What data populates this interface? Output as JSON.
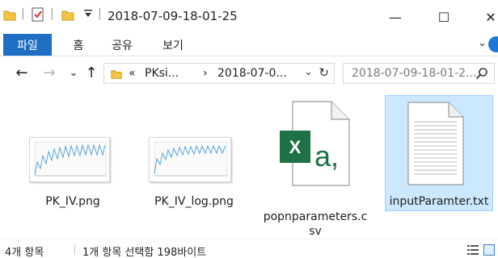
{
  "window": {
    "title": "2018-07-09-18-01-25",
    "buttons": {
      "minimize": "—",
      "maximize": "☐",
      "close": "✕"
    }
  },
  "ribbon": {
    "tabs": [
      {
        "label": "파일"
      },
      {
        "label": "홈"
      },
      {
        "label": "공유"
      },
      {
        "label": "보기"
      }
    ],
    "expand_glyph": "⌄"
  },
  "nav": {
    "back": "←",
    "forward": "→",
    "recent": "⌄",
    "up": "↑",
    "address": {
      "overflow": "«",
      "crumbs": [
        "PKsi...",
        "2018-07-0..."
      ],
      "separator": "›",
      "dropdown": "⌄",
      "refresh": "↻"
    },
    "search_placeholder": "2018-07-09-18-01-2..."
  },
  "files": [
    {
      "name": "PK_IV.png",
      "icon": "png-thumbnail"
    },
    {
      "name": "PK_IV_log.png",
      "icon": "png-thumbnail"
    },
    {
      "name_line1": "popnparameters.c",
      "name_line2": "sv",
      "icon": "excel-csv-icon"
    },
    {
      "name": "inputParamter.txt",
      "icon": "text-file-icon",
      "selected": true
    }
  ],
  "status": {
    "item_count": "4개 항목",
    "selection": "1개 항목 선택함 198바이트"
  },
  "colors": {
    "accent": "#1e6ec3",
    "selection_bg": "#cce8ff",
    "selection_border": "#99d1ff",
    "excel_green": "#1e7145",
    "folder_yellow": "#f4c542"
  }
}
